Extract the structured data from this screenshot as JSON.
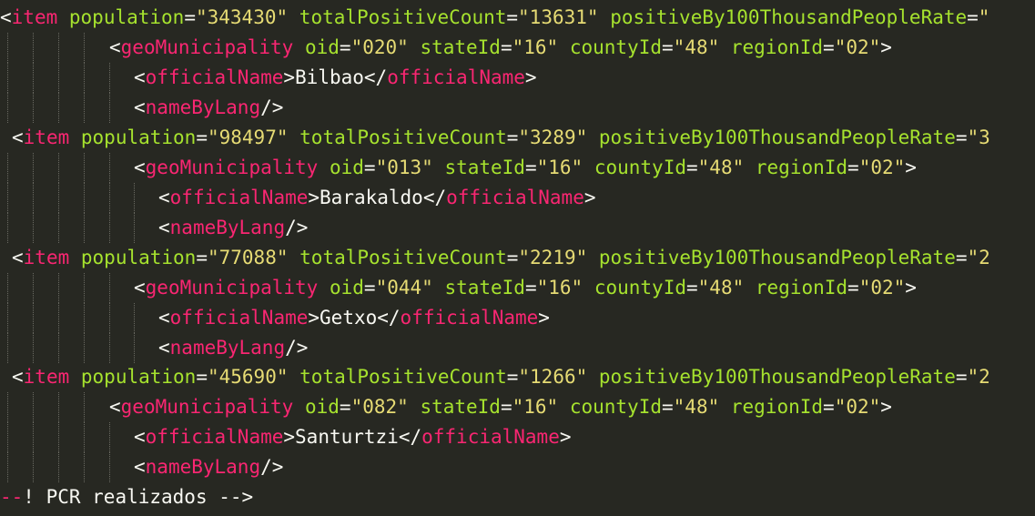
{
  "colors": {
    "background": "#272822",
    "punctuation": "#f8f8f2",
    "tag": "#f92672",
    "attribute": "#a6e22e",
    "string": "#e6db74",
    "text": "#f8f8f2",
    "indent_guide": "#6a6a62"
  },
  "lines": [
    [
      {
        "t": "punct",
        "s": "<"
      },
      {
        "t": "tag",
        "s": "item"
      },
      {
        "t": "punct",
        "s": " "
      },
      {
        "t": "attr",
        "s": "population"
      },
      {
        "t": "punct",
        "s": "="
      },
      {
        "t": "string",
        "s": "\"343430\""
      },
      {
        "t": "punct",
        "s": " "
      },
      {
        "t": "attr",
        "s": "totalPositiveCount"
      },
      {
        "t": "punct",
        "s": "="
      },
      {
        "t": "string",
        "s": "\"13631\""
      },
      {
        "t": "punct",
        "s": " "
      },
      {
        "t": "attr",
        "s": "positiveBy100ThousandPeopleRate"
      },
      {
        "t": "punct",
        "s": "="
      },
      {
        "t": "string",
        "s": "\""
      }
    ],
    [
      {
        "t": "punct",
        "s": "<"
      },
      {
        "t": "tag",
        "s": "geoMunicipality"
      },
      {
        "t": "punct",
        "s": " "
      },
      {
        "t": "attr",
        "s": "oid"
      },
      {
        "t": "punct",
        "s": "="
      },
      {
        "t": "string",
        "s": "\"020\""
      },
      {
        "t": "punct",
        "s": " "
      },
      {
        "t": "attr",
        "s": "stateId"
      },
      {
        "t": "punct",
        "s": "="
      },
      {
        "t": "string",
        "s": "\"16\""
      },
      {
        "t": "punct",
        "s": " "
      },
      {
        "t": "attr",
        "s": "countyId"
      },
      {
        "t": "punct",
        "s": "="
      },
      {
        "t": "string",
        "s": "\"48\""
      },
      {
        "t": "punct",
        "s": " "
      },
      {
        "t": "attr",
        "s": "regionId"
      },
      {
        "t": "punct",
        "s": "="
      },
      {
        "t": "string",
        "s": "\"02\""
      },
      {
        "t": "punct",
        "s": ">"
      }
    ],
    [
      {
        "t": "punct",
        "s": "<"
      },
      {
        "t": "tag",
        "s": "officialName"
      },
      {
        "t": "punct",
        "s": ">"
      },
      {
        "t": "text",
        "s": "Bilbao"
      },
      {
        "t": "punct",
        "s": "</"
      },
      {
        "t": "tag",
        "s": "officialName"
      },
      {
        "t": "punct",
        "s": ">"
      }
    ],
    [
      {
        "t": "punct",
        "s": "<"
      },
      {
        "t": "tag",
        "s": "nameByLang"
      },
      {
        "t": "punct",
        "s": "/>"
      }
    ],
    [
      {
        "t": "punct",
        "s": "<"
      },
      {
        "t": "tag",
        "s": "item"
      },
      {
        "t": "punct",
        "s": " "
      },
      {
        "t": "attr",
        "s": "population"
      },
      {
        "t": "punct",
        "s": "="
      },
      {
        "t": "string",
        "s": "\"98497\""
      },
      {
        "t": "punct",
        "s": " "
      },
      {
        "t": "attr",
        "s": "totalPositiveCount"
      },
      {
        "t": "punct",
        "s": "="
      },
      {
        "t": "string",
        "s": "\"3289\""
      },
      {
        "t": "punct",
        "s": " "
      },
      {
        "t": "attr",
        "s": "positiveBy100ThousandPeopleRate"
      },
      {
        "t": "punct",
        "s": "="
      },
      {
        "t": "string",
        "s": "\"3"
      }
    ],
    [
      {
        "t": "punct",
        "s": "<"
      },
      {
        "t": "tag",
        "s": "geoMunicipality"
      },
      {
        "t": "punct",
        "s": " "
      },
      {
        "t": "attr",
        "s": "oid"
      },
      {
        "t": "punct",
        "s": "="
      },
      {
        "t": "string",
        "s": "\"013\""
      },
      {
        "t": "punct",
        "s": " "
      },
      {
        "t": "attr",
        "s": "stateId"
      },
      {
        "t": "punct",
        "s": "="
      },
      {
        "t": "string",
        "s": "\"16\""
      },
      {
        "t": "punct",
        "s": " "
      },
      {
        "t": "attr",
        "s": "countyId"
      },
      {
        "t": "punct",
        "s": "="
      },
      {
        "t": "string",
        "s": "\"48\""
      },
      {
        "t": "punct",
        "s": " "
      },
      {
        "t": "attr",
        "s": "regionId"
      },
      {
        "t": "punct",
        "s": "="
      },
      {
        "t": "string",
        "s": "\"02\""
      },
      {
        "t": "punct",
        "s": ">"
      }
    ],
    [
      {
        "t": "punct",
        "s": "<"
      },
      {
        "t": "tag",
        "s": "officialName"
      },
      {
        "t": "punct",
        "s": ">"
      },
      {
        "t": "text",
        "s": "Barakaldo"
      },
      {
        "t": "punct",
        "s": "</"
      },
      {
        "t": "tag",
        "s": "officialName"
      },
      {
        "t": "punct",
        "s": ">"
      }
    ],
    [
      {
        "t": "punct",
        "s": "<"
      },
      {
        "t": "tag",
        "s": "nameByLang"
      },
      {
        "t": "punct",
        "s": "/>"
      }
    ],
    [
      {
        "t": "punct",
        "s": "<"
      },
      {
        "t": "tag",
        "s": "item"
      },
      {
        "t": "punct",
        "s": " "
      },
      {
        "t": "attr",
        "s": "population"
      },
      {
        "t": "punct",
        "s": "="
      },
      {
        "t": "string",
        "s": "\"77088\""
      },
      {
        "t": "punct",
        "s": " "
      },
      {
        "t": "attr",
        "s": "totalPositiveCount"
      },
      {
        "t": "punct",
        "s": "="
      },
      {
        "t": "string",
        "s": "\"2219\""
      },
      {
        "t": "punct",
        "s": " "
      },
      {
        "t": "attr",
        "s": "positiveBy100ThousandPeopleRate"
      },
      {
        "t": "punct",
        "s": "="
      },
      {
        "t": "string",
        "s": "\"2"
      }
    ],
    [
      {
        "t": "punct",
        "s": "<"
      },
      {
        "t": "tag",
        "s": "geoMunicipality"
      },
      {
        "t": "punct",
        "s": " "
      },
      {
        "t": "attr",
        "s": "oid"
      },
      {
        "t": "punct",
        "s": "="
      },
      {
        "t": "string",
        "s": "\"044\""
      },
      {
        "t": "punct",
        "s": " "
      },
      {
        "t": "attr",
        "s": "stateId"
      },
      {
        "t": "punct",
        "s": "="
      },
      {
        "t": "string",
        "s": "\"16\""
      },
      {
        "t": "punct",
        "s": " "
      },
      {
        "t": "attr",
        "s": "countyId"
      },
      {
        "t": "punct",
        "s": "="
      },
      {
        "t": "string",
        "s": "\"48\""
      },
      {
        "t": "punct",
        "s": " "
      },
      {
        "t": "attr",
        "s": "regionId"
      },
      {
        "t": "punct",
        "s": "="
      },
      {
        "t": "string",
        "s": "\"02\""
      },
      {
        "t": "punct",
        "s": ">"
      }
    ],
    [
      {
        "t": "punct",
        "s": "<"
      },
      {
        "t": "tag",
        "s": "officialName"
      },
      {
        "t": "punct",
        "s": ">"
      },
      {
        "t": "text",
        "s": "Getxo"
      },
      {
        "t": "punct",
        "s": "</"
      },
      {
        "t": "tag",
        "s": "officialName"
      },
      {
        "t": "punct",
        "s": ">"
      }
    ],
    [
      {
        "t": "punct",
        "s": "<"
      },
      {
        "t": "tag",
        "s": "nameByLang"
      },
      {
        "t": "punct",
        "s": "/>"
      }
    ],
    [
      {
        "t": "punct",
        "s": "<"
      },
      {
        "t": "tag",
        "s": "item"
      },
      {
        "t": "punct",
        "s": " "
      },
      {
        "t": "attr",
        "s": "population"
      },
      {
        "t": "punct",
        "s": "="
      },
      {
        "t": "string",
        "s": "\"45690\""
      },
      {
        "t": "punct",
        "s": " "
      },
      {
        "t": "attr",
        "s": "totalPositiveCount"
      },
      {
        "t": "punct",
        "s": "="
      },
      {
        "t": "string",
        "s": "\"1266\""
      },
      {
        "t": "punct",
        "s": " "
      },
      {
        "t": "attr",
        "s": "positiveBy100ThousandPeopleRate"
      },
      {
        "t": "punct",
        "s": "="
      },
      {
        "t": "string",
        "s": "\"2"
      }
    ],
    [
      {
        "t": "punct",
        "s": "<"
      },
      {
        "t": "tag",
        "s": "geoMunicipality"
      },
      {
        "t": "punct",
        "s": " "
      },
      {
        "t": "attr",
        "s": "oid"
      },
      {
        "t": "punct",
        "s": "="
      },
      {
        "t": "string",
        "s": "\"082\""
      },
      {
        "t": "punct",
        "s": " "
      },
      {
        "t": "attr",
        "s": "stateId"
      },
      {
        "t": "punct",
        "s": "="
      },
      {
        "t": "string",
        "s": "\"16\""
      },
      {
        "t": "punct",
        "s": " "
      },
      {
        "t": "attr",
        "s": "countyId"
      },
      {
        "t": "punct",
        "s": "="
      },
      {
        "t": "string",
        "s": "\"48\""
      },
      {
        "t": "punct",
        "s": " "
      },
      {
        "t": "attr",
        "s": "regionId"
      },
      {
        "t": "punct",
        "s": "="
      },
      {
        "t": "string",
        "s": "\"02\""
      },
      {
        "t": "punct",
        "s": ">"
      }
    ],
    [
      {
        "t": "punct",
        "s": "<"
      },
      {
        "t": "tag",
        "s": "officialName"
      },
      {
        "t": "punct",
        "s": ">"
      },
      {
        "t": "text",
        "s": "Santurtzi"
      },
      {
        "t": "punct",
        "s": "</"
      },
      {
        "t": "tag",
        "s": "officialName"
      },
      {
        "t": "punct",
        "s": ">"
      }
    ],
    [
      {
        "t": "punct",
        "s": "<"
      },
      {
        "t": "tag",
        "s": "nameByLang"
      },
      {
        "t": "punct",
        "s": "/>"
      }
    ],
    [
      {
        "t": "comment-dash",
        "s": "--"
      },
      {
        "t": "comment",
        "s": "! PCR realizados -->"
      }
    ]
  ]
}
